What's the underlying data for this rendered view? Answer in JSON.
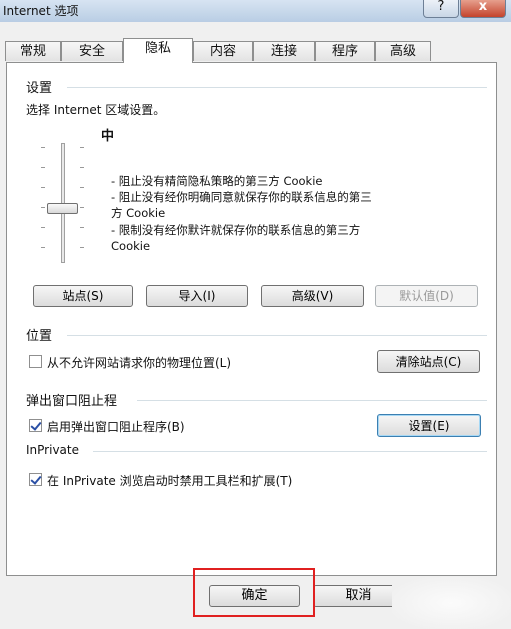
{
  "window": {
    "title": "Internet 选项",
    "help_label": "?",
    "close_label": "x"
  },
  "tabs": [
    {
      "label": "常规"
    },
    {
      "label": "安全"
    },
    {
      "label": "隐私",
      "active": true
    },
    {
      "label": "内容"
    },
    {
      "label": "连接"
    },
    {
      "label": "程序"
    },
    {
      "label": "高级"
    }
  ],
  "settings": {
    "group_title": "设置",
    "instruction": "选择 Internet 区域设置。",
    "level_title": "中",
    "desc_line1": "- 阻止没有精简隐私策略的第三方 Cookie",
    "desc_line2": "- 阻止没有经你明确同意就保存你的联系信息的第三",
    "desc_line3": "方 Cookie",
    "desc_line4": "- 限制没有经你默许就保存你的联系信息的第三方",
    "desc_line5": "Cookie",
    "slider_level_fraction": 0.5,
    "buttons": {
      "sites": "站点(S)",
      "import": "导入(I)",
      "advanced": "高级(V)",
      "default": "默认值(D)"
    }
  },
  "location": {
    "group_title": "位置",
    "checkbox_label": "从不允许网站请求你的物理位置(L)",
    "checked": false,
    "clear_sites_button": "清除站点(C)"
  },
  "popup": {
    "group_title": "弹出窗口阻止程",
    "checkbox_label": "启用弹出窗口阻止程序(B)",
    "checked": true,
    "settings_button": "设置(E)"
  },
  "inprivate": {
    "group_title": "InPrivate",
    "checkbox_label": "在 InPrivate 浏览启动时禁用工具栏和扩展(T)",
    "checked": true
  },
  "footer": {
    "ok_button": "确定",
    "cancel_button": "取消"
  }
}
